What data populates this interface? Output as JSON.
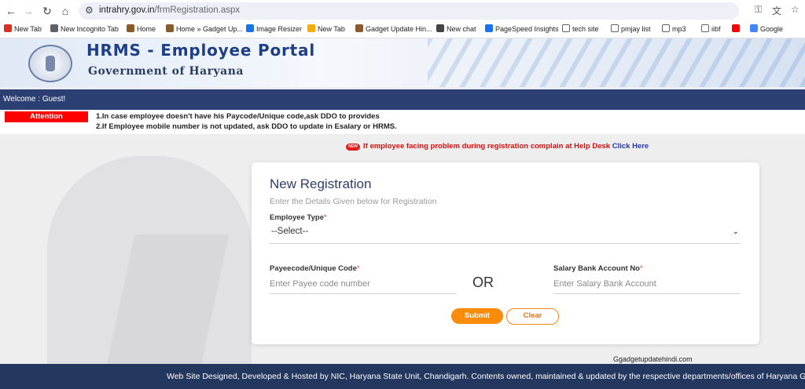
{
  "browser": {
    "url_host": "intrahry.gov.in",
    "url_path": "/frmRegistration.aspx"
  },
  "bookmarks": [
    {
      "label": "New Tab",
      "icon": "red-star-icon",
      "color": "#d93025"
    },
    {
      "label": "New Incognito Tab",
      "icon": "incognito-icon",
      "color": "#5f6368"
    },
    {
      "label": "Home",
      "icon": "site-icon",
      "color": "#8b5a2b"
    },
    {
      "label": "Home » Gadget Up...",
      "icon": "site-icon",
      "color": "#8b5a2b"
    },
    {
      "label": "Image Resizer",
      "icon": "image-icon",
      "color": "#1a73e8"
    },
    {
      "label": "New Tab",
      "icon": "dash-icon",
      "color": "#f9ab00"
    },
    {
      "label": "Gadget Update Hin...",
      "icon": "site-icon",
      "color": "#8b5a2b"
    },
    {
      "label": "New chat",
      "icon": "chat-icon",
      "color": "#444444"
    },
    {
      "label": "PageSpeed Insights",
      "icon": "pagespeed-icon",
      "color": "#1a73e8"
    },
    {
      "label": "tech site",
      "icon": "folder-icon",
      "color": "#5f6368"
    },
    {
      "label": "pmjay list",
      "icon": "folder-icon",
      "color": "#5f6368"
    },
    {
      "label": "mp3",
      "icon": "folder-icon",
      "color": "#5f6368"
    },
    {
      "label": "iibf",
      "icon": "folder-icon",
      "color": "#5f6368"
    },
    {
      "label": "",
      "icon": "youtube-icon",
      "color": "#ff0000"
    },
    {
      "label": "Google",
      "icon": "google-icon",
      "color": "#4285f4"
    }
  ],
  "header": {
    "title": "HRMS - Employee Portal",
    "subtitle": "Government of Haryana"
  },
  "welcome": "Welcome : Guest!",
  "attention": {
    "label": "Attention",
    "lines": [
      "1.In case employee doesn't have his Paycode/Unique code,ask DDO to provides",
      "2.If Employee mobile number is not updated, ask DDO to update in Esalary or HRMS."
    ]
  },
  "help": {
    "badge": "NEW",
    "text": "If employee facing problem during registration complain at Help Desk",
    "link": "Click Here"
  },
  "form": {
    "title": "New Registration",
    "subtitle": "Enter the Details Given below for Registration",
    "employee_type_label": "Employee Type",
    "employee_type_value": "--Select--",
    "payee_label": "Payeecode/Unique Code",
    "payee_placeholder": "Enter Payee code number",
    "or_text": "OR",
    "salary_label": "Salary Bank Account No",
    "salary_placeholder": "Enter Salary Bank Account",
    "required_mark": "*",
    "submit": "Submit",
    "clear": "Clear"
  },
  "watermark": "Ggadgetupdatehindi.com",
  "footer": "Web Site Designed, Developed & Hosted by NIC, Haryana State Unit, Chandigarh. Contents owned, maintained & updated by the respective departments/offices of Haryana Go",
  "colors": {
    "banner_title": "#1e3f86",
    "welcome_bar": "#2b3f72",
    "attention": "#ff0000",
    "accent_orange": "#fb8c0b",
    "footer": "#24375f"
  }
}
